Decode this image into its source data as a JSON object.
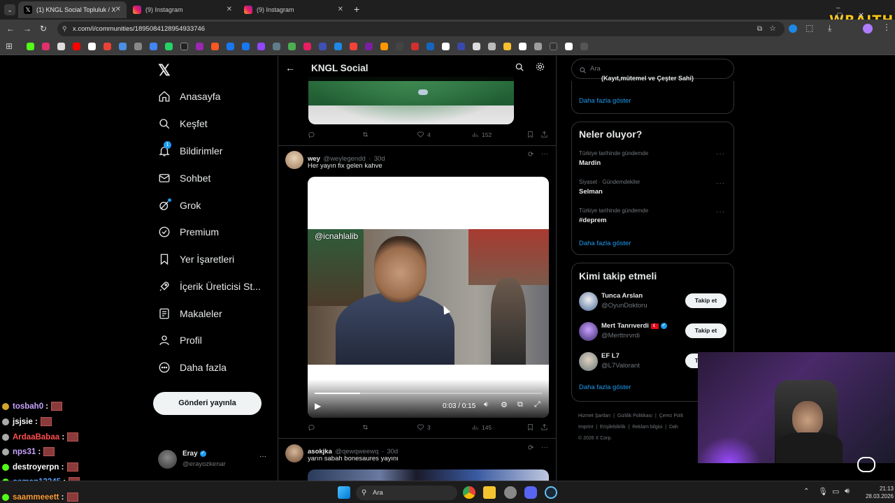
{
  "browser": {
    "tabs": [
      {
        "label": "(1) KNGL Social Topluluk / X",
        "active": true
      },
      {
        "label": "(9) Instagram",
        "active": false
      },
      {
        "label": "(9) Instagram",
        "active": false
      }
    ],
    "new_tab": "+",
    "url": "x.com/i/communities/1895084128954933746"
  },
  "overlay": {
    "brand": "WRAITH"
  },
  "sidebar": {
    "items": [
      {
        "label": "Anasayfa",
        "icon": "home-icon"
      },
      {
        "label": "Keşfet",
        "icon": "search-icon"
      },
      {
        "label": "Bildirimler",
        "icon": "bell-icon",
        "badge": "1"
      },
      {
        "label": "Sohbet",
        "icon": "mail-icon"
      },
      {
        "label": "Grok",
        "icon": "grok-icon"
      },
      {
        "label": "Premium",
        "icon": "premium-icon"
      },
      {
        "label": "Yer İşaretleri",
        "icon": "bookmark-icon"
      },
      {
        "label": "İçerik Üreticisi St...",
        "icon": "rocket-icon"
      },
      {
        "label": "Makaleler",
        "icon": "article-icon"
      },
      {
        "label": "Profil",
        "icon": "person-icon"
      },
      {
        "label": "Daha fazla",
        "icon": "more-circle-icon"
      }
    ],
    "post_button": "Gönderi yayınla",
    "account": {
      "name": "Eray",
      "handle": "@erayozkenar",
      "more": "···"
    }
  },
  "feed": {
    "title": "KNGL Social",
    "tweets": [
      {
        "stats": {
          "replies": "",
          "retweets": "",
          "likes": "4",
          "views": "152"
        }
      },
      {
        "name": "wey",
        "handle": "@weylegendd",
        "time": "30d",
        "text": "Her yayın fix gelen kahve",
        "video": {
          "watermark": "@icnahlalib",
          "time": "0:03 / 0:15",
          "progress": 0.2
        },
        "stats": {
          "replies": "",
          "retweets": "",
          "likes": "3",
          "views": "145"
        }
      },
      {
        "name": "asokjka",
        "handle": "@qewqweewq",
        "time": "30d",
        "text": "yarın sabah bonesaures yayını"
      }
    ]
  },
  "right": {
    "search_placeholder": "Ara",
    "top_card": {
      "partial_text": "(Kayıt,mütemel ve Çeşter Sahi)",
      "show_more": "Daha fazla göster"
    },
    "trends": {
      "title": "Neler oluyor?",
      "items": [
        {
          "meta": "Türkiye tarihinde gündemde",
          "name": "Mardin"
        },
        {
          "meta": "Siyaset · Gündemdekiler",
          "name": "Selman"
        },
        {
          "meta": "Türkiye tarihinde gündemde",
          "name": "#deprem"
        }
      ],
      "show_more": "Daha fazla göster"
    },
    "who_to_follow": {
      "title": "Kimi takip etmeli",
      "items": [
        {
          "name": "Tunca Arslan",
          "handle": "@OyunDoktoru",
          "button": "Takip et"
        },
        {
          "name": "Mert Tanrıverdi",
          "handle": "@Merttnrvrdi",
          "button": "Takip et",
          "flag": true
        },
        {
          "name": "EF L7",
          "handle": "@L7Valorant",
          "button": "Takip et"
        }
      ],
      "show_more": "Daha fazla göster"
    },
    "footer": {
      "line1": [
        "Hizmet Şartları",
        "Gizlilik Politikası",
        "Çerez Polit"
      ],
      "line2": [
        "Imprint",
        "Erişilebilirlik",
        "Reklam bilgisi",
        "Dah"
      ],
      "copyright": "© 2026 X Corp."
    }
  },
  "chat": [
    {
      "user": "tosbah0",
      "color": "#c8a2ff"
    },
    {
      "user": "jsjsie",
      "color": "#ffffff"
    },
    {
      "user": "ArdaaBabaa",
      "color": "#ff4d4d"
    },
    {
      "user": "nps31",
      "color": "#c8a2ff"
    },
    {
      "user": "destroyerpn",
      "color": "#ffffff"
    },
    {
      "user": "osman13245",
      "color": "#5aa0ff"
    },
    {
      "user": "saammeeett",
      "color": "#ff9f3a"
    }
  ],
  "taskbar": {
    "search": "Ara",
    "time": "21:13",
    "date": "28.03.2026"
  }
}
